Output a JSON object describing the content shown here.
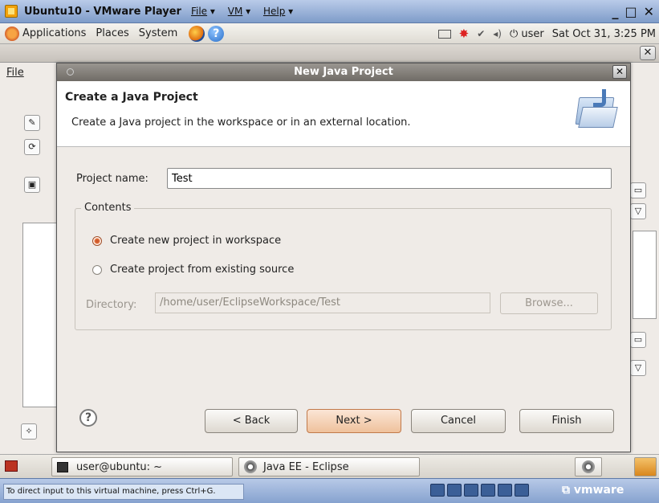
{
  "vm_window": {
    "title": "Ubuntu10 - VMware Player",
    "menus": [
      {
        "label": "File"
      },
      {
        "label": "VM"
      },
      {
        "label": "Help"
      }
    ],
    "controls": {
      "minimize": "_",
      "maximize": "□",
      "close": "✕"
    }
  },
  "top_panel": {
    "menus": [
      "Applications",
      "Places",
      "System"
    ],
    "user": "user",
    "clock": "Sat Oct 31,  3:25 PM"
  },
  "eclipse": {
    "file_menu": "File"
  },
  "dialog": {
    "title": "New Java Project",
    "header": "Create a Java Project",
    "subtitle": "Create a Java project in the workspace or in an external location.",
    "project_name_label": "Project name:",
    "project_name_value": "Test",
    "contents_label": "Contents",
    "radio_new": "Create new project in workspace",
    "radio_existing": "Create project from existing source",
    "selected_option": "Create new project in workspace",
    "directory_label": "Directory:",
    "directory_value": "/home/user/EclipseWorkspace/Test",
    "browse_label": "Browse...",
    "buttons": {
      "back": "< Back",
      "next": "Next >",
      "cancel": "Cancel",
      "finish": "Finish"
    }
  },
  "taskbar": {
    "items": [
      {
        "label": "user@ubuntu: ~"
      },
      {
        "label": "Java EE - Eclipse"
      }
    ]
  },
  "status_bar": {
    "text": "To direct input to this virtual machine, press Ctrl+G.",
    "brand": "vmware"
  }
}
